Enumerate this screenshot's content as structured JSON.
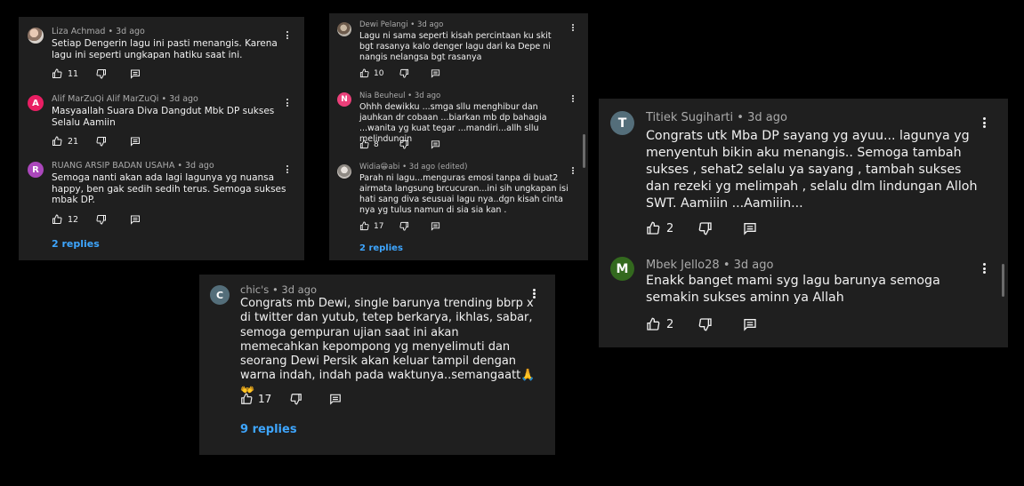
{
  "panel1": {
    "comments": [
      {
        "avatar_letter": "",
        "name": "Liza Achmad",
        "ago": "3d ago",
        "text": "Setiap Dengerin lagu ini pasti menangis. Karena lagu ini seperti ungkapan hatiku saat ini.",
        "likes": "11"
      },
      {
        "avatar_letter": "A",
        "avatar_color": "#e91e63",
        "name": "Alif MarZuQi Alif MarZuQi",
        "ago": "3d ago",
        "text": "Masyaallah Suara Diva Dangdut Mbk DP  sukses Selalu Aamiin",
        "likes": "21"
      },
      {
        "avatar_letter": "R",
        "avatar_color": "#ab47bc",
        "name": "RUANG ARSIP BADAN USAHA",
        "ago": "3d ago",
        "text": "Semoga nanti akan ada lagi lagunya yg nuansa happy, ben gak sedih sedih terus. Semoga sukses mbak DP.",
        "likes": "12"
      }
    ],
    "replies_label": "2 replies"
  },
  "panel2": {
    "comments": [
      {
        "avatar_letter": "",
        "name": "Dewi Pelangi",
        "ago": "3d ago",
        "text": "Lagu ni sama seperti kisah percintaan ku skit bgt rasanya kalo denger lagu dari ka Depe ni nangis nelangsa bgt rasanya",
        "likes": "10"
      },
      {
        "avatar_letter": "N",
        "avatar_color": "#ec407a",
        "name": "Nia Beuheul",
        "ago": "3d ago",
        "text": "Ohhh dewikku ...smga sllu menghibur dan jauhkan dr cobaan ...biarkan mb dp bahagia ...wanita yg kuat tegar ...mandiri...allh sllu melindungin",
        "likes": "8"
      },
      {
        "avatar_letter": "",
        "name": "Widia😁abi",
        "ago": "3d ago",
        "edited": "(edited)",
        "text": "Parah ni lagu...menguras emosi tanpa di buat2 airmata langsung brcucuran...ini sih ungkapan isi hati sang diva seusuai lagu nya..dgn kisah cinta nya yg tulus namun di sia sia kan .",
        "likes": "17"
      }
    ],
    "replies_label": "2 replies"
  },
  "panel3": {
    "comments": [
      {
        "avatar_letter": "C",
        "avatar_color": "#546e7a",
        "name": "chic's",
        "ago": "3d ago",
        "text": "Congrats mb Dewi,  single barunya trending bbrp x di twitter dan yutub, tetep berkarya, ikhlas, sabar, semoga gempuran ujian saat ini akan memecahkan kepompong yg menyelimuti dan seorang Dewi Persik akan keluar tampil dengan warna indah, indah pada waktunya..semangaatt🙏👐",
        "likes": "17"
      }
    ],
    "replies_label": "9 replies"
  },
  "panel4": {
    "comments": [
      {
        "avatar_letter": "T",
        "avatar_color": "#546e7a",
        "name": "Titiek Sugiharti",
        "ago": "3d ago",
        "text": "Congrats utk Mba DP sayang yg ayuu... lagunya yg menyentuh bikin aku menangis.. Semoga tambah sukses , sehat2 selalu ya sayang , tambah sukses dan rezeki yg melimpah , selalu dlm lindungan Alloh SWT. Aamiiin ...Aamiiin...",
        "likes": "2"
      },
      {
        "avatar_letter": "M",
        "avatar_color": "#33691e",
        "name": "Mbek Jello28",
        "ago": "3d ago",
        "text": "Enakk banget mami syg lagu barunya semoga semakin sukses aminn ya Allah",
        "likes": "2"
      }
    ]
  },
  "icons": {
    "like": "thumb-up-icon",
    "dislike": "thumb-down-icon",
    "reply": "comment-icon",
    "menu": "more-vert-icon"
  }
}
